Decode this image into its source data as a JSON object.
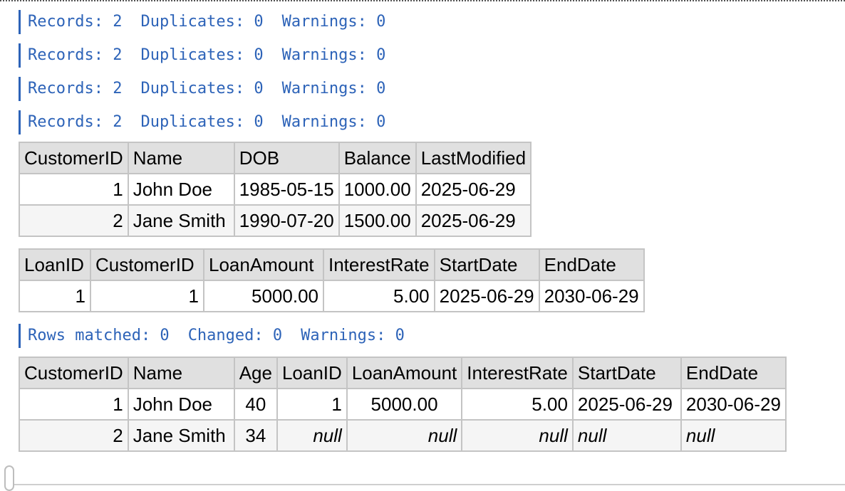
{
  "messages": [
    {
      "records": "Records: 2",
      "duplicates": "Duplicates: 0",
      "warnings": "Warnings: 0"
    },
    {
      "records": "Records: 2",
      "duplicates": "Duplicates: 0",
      "warnings": "Warnings: 0"
    },
    {
      "records": "Records: 2",
      "duplicates": "Duplicates: 0",
      "warnings": "Warnings: 0"
    },
    {
      "records": "Records: 2",
      "duplicates": "Duplicates: 0",
      "warnings": "Warnings: 0"
    }
  ],
  "customers": {
    "columns": [
      "CustomerID",
      "Name",
      "DOB",
      "Balance",
      "LastModified"
    ],
    "rows": [
      [
        "1",
        "John Doe",
        "1985-05-15",
        "1000.00",
        "2025-06-29"
      ],
      [
        "2",
        "Jane Smith",
        "1990-07-20",
        "1500.00",
        "2025-06-29"
      ]
    ]
  },
  "loans": {
    "columns": [
      "LoanID",
      "CustomerID",
      "LoanAmount",
      "InterestRate",
      "StartDate",
      "EndDate"
    ],
    "rows": [
      [
        "1",
        "1",
        "5000.00",
        "5.00",
        "2025-06-29",
        "2030-06-29"
      ]
    ]
  },
  "update_message": {
    "matched": "Rows matched: 0",
    "changed": "Changed: 0",
    "warnings": "Warnings: 0"
  },
  "joined": {
    "columns": [
      "CustomerID",
      "Name",
      "Age",
      "LoanID",
      "LoanAmount",
      "InterestRate",
      "StartDate",
      "EndDate"
    ],
    "rows": [
      [
        "1",
        "John Doe",
        "40",
        "1",
        "5000.00",
        "5.00",
        "2025-06-29",
        "2030-06-29"
      ],
      [
        "2",
        "Jane Smith",
        "34",
        "null",
        "null",
        "null",
        "null",
        "null"
      ]
    ]
  }
}
